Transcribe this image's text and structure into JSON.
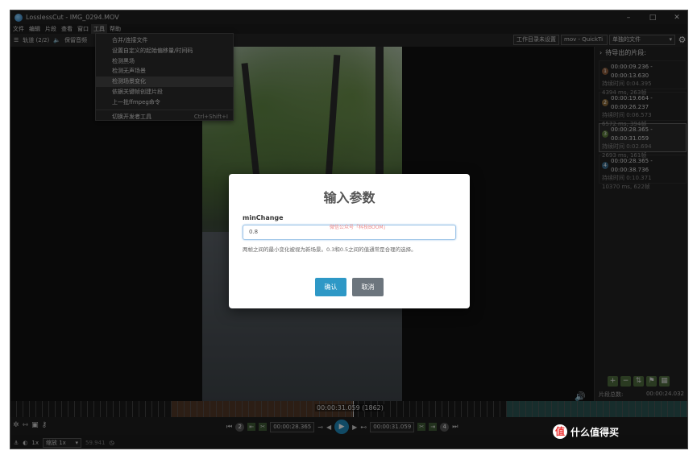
{
  "titlebar": {
    "title": "LosslessCut - IMG_0294.MOV",
    "minimize": "–",
    "maximize": "□",
    "close": "✕"
  },
  "menubar": [
    "文件",
    "编辑",
    "片段",
    "查看",
    "窗口",
    "工具",
    "帮助"
  ],
  "toolbar": {
    "tracks_label": "轨道 (2/2)",
    "keep_audio_label": "保留音频",
    "workdir_button": "工作目录未设置",
    "format_select": "mov - QuickTi",
    "output_mode_select": "单独的文件"
  },
  "tools_menu": {
    "items": [
      {
        "label": "合并/连接文件"
      },
      {
        "label": "设置自定义的起始偏移量/时间码"
      },
      {
        "label": "检测黑场"
      },
      {
        "label": "检测无声场景"
      },
      {
        "label": "检测场景变化",
        "highlighted": true
      },
      {
        "label": "依据关键帧创建片段"
      },
      {
        "label": "上一批ffmpeg命令"
      }
    ],
    "dev_tools": {
      "label": "切换开发者工具",
      "shortcut": "Ctrl+Shift+I"
    }
  },
  "sidebar": {
    "header": "待导出的片段:",
    "segments": [
      {
        "num": "1",
        "range": "00:00:09.236 - 00:00:13.630",
        "duration": "持续时间 0:04.395",
        "frames": "4394 ms, 263帧",
        "color": "#8a5a3a"
      },
      {
        "num": "2",
        "range": "00:00:19.664 - 00:00:26.237",
        "duration": "持续时间 0:06.573",
        "frames": "6572 ms, 394帧",
        "color": "#8a6a3a"
      },
      {
        "num": "3",
        "range": "00:00:28.365 - 00:00:31.059",
        "duration": "持续时间 0:02.694",
        "frames": "2693 ms, 161帧",
        "color": "#5a7a3a",
        "selected": true
      },
      {
        "num": "4",
        "range": "00:00:28.365 - 00:00:38.736",
        "duration": "持续时间 0:10.371",
        "frames": "10370 ms, 622帧",
        "color": "#3a6a8a"
      }
    ],
    "total_label": "片段总数:",
    "total_value": "00:00:24.032"
  },
  "timeline": {
    "current_time": "00:00:31.059 (1862)"
  },
  "controls": {
    "seg_start_num": "2",
    "start_time": "00:00:28.365",
    "end_time": "00:00:31.059",
    "seg_end_num": "4"
  },
  "bottombar": {
    "speed": "1x",
    "zoom_select": "缩放 1x",
    "fps": "59.941"
  },
  "dialog": {
    "title": "输入参数",
    "field_label": "minChange",
    "watermark": "微信公众号「科技BOOM」",
    "field_value": "0.8",
    "help_text": "两帧之间的最小变化被视为新场景。0.3和0.5之间的值通常是合理的选择。",
    "ok_label": "确认",
    "cancel_label": "取消"
  },
  "corner_watermark": {
    "text": "什么值得买",
    "glyph": "值"
  },
  "colors": {
    "accent": "#2e98c6",
    "cancel": "#6c757d"
  },
  "icons": [
    "app-icon",
    "list-icon",
    "speaker-icon",
    "settings-gear-icon",
    "chevron-right-icon",
    "play-icon",
    "volume-icon"
  ]
}
